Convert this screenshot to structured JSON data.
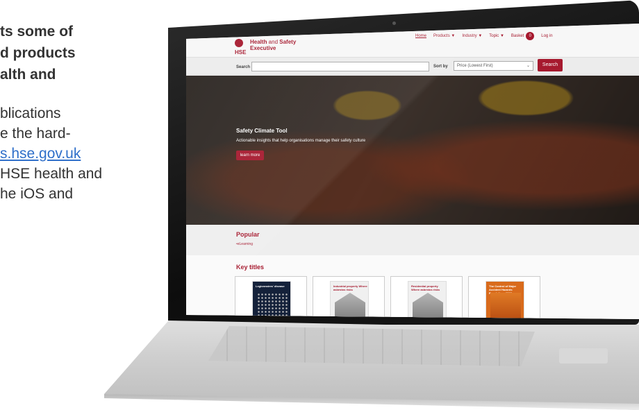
{
  "copy": {
    "heading_lines": "ts some of\nd products\nalth and",
    "body_before_link": "blications\ne the hard-\n",
    "link_text": "s.hse.gov.uk",
    "body_after_link": "\nHSE health and\nhe iOS and"
  },
  "site": {
    "brand_name_1": "Health",
    "brand_name_and": " and ",
    "brand_name_2": "Safety",
    "brand_name_3": "Executive",
    "logo_letters": "HSE",
    "nav": {
      "home": "Home",
      "products": "Products ▼",
      "industry": "Industry ▼",
      "topic": "Topic ▼",
      "basket": "Basket",
      "basket_count": "0",
      "login": "Log in"
    },
    "search": {
      "label": "Search",
      "value": "",
      "sort_label": "Sort by",
      "sort_value": "Price (Lowest First)",
      "button": "Search"
    },
    "hero": {
      "title": "Safety Climate Tool",
      "subtitle": "Actionable insights that help organisations manage their safety culture",
      "button": "learn more"
    },
    "popular": {
      "title": "Popular",
      "link": "•eLearning"
    },
    "key_titles": {
      "title": "Key titles",
      "books": [
        {
          "cover_title": "Legionnaires' disease"
        },
        {
          "cover_title": "Industrial property\nWhere asbestos risks"
        },
        {
          "cover_title": "Residential property\nWhere asbestos risks"
        },
        {
          "cover_title": "The Control of Major Accident Hazards Regulations 2015"
        }
      ]
    }
  },
  "colors": {
    "brand": "#a6192e",
    "link": "#2f6fc9"
  }
}
